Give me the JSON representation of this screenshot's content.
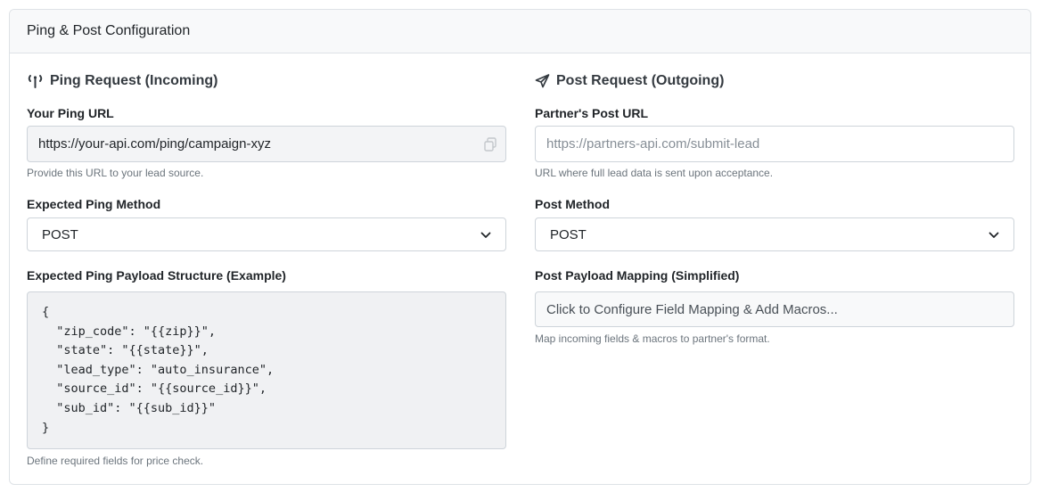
{
  "header": {
    "title": "Ping & Post Configuration"
  },
  "ping": {
    "title": "Ping Request (Incoming)",
    "url_label": "Your Ping URL",
    "url_value": "https://your-api.com/ping/campaign-xyz",
    "url_help": "Provide this URL to your lead source.",
    "method_label": "Expected Ping Method",
    "method_value": "POST",
    "payload_label": "Expected Ping Payload Structure (Example)",
    "payload_lines": [
      "{",
      "  \"zip_code\": \"{{zip}}\",",
      "  \"state\": \"{{state}}\",",
      "  \"lead_type\": \"auto_insurance\",",
      "  \"source_id\": \"{{source_id}}\",",
      "  \"sub_id\": \"{{sub_id}}\"",
      "}"
    ],
    "payload_help": "Define required fields for price check."
  },
  "post": {
    "title": "Post Request (Outgoing)",
    "url_label": "Partner's Post URL",
    "url_placeholder": "https://partners-api.com/submit-lead",
    "url_help": "URL where full lead data is sent upon acceptance.",
    "method_label": "Post Method",
    "method_value": "POST",
    "mapping_label": "Post Payload Mapping (Simplified)",
    "mapping_button": "Click to Configure Field Mapping & Add Macros...",
    "mapping_help": "Map incoming fields & macros to partner's format."
  },
  "icons": {
    "ping": "broadcast-tower-icon",
    "post": "paper-plane-icon",
    "copy": "copy-icon",
    "select": "chevron-down-icon"
  }
}
